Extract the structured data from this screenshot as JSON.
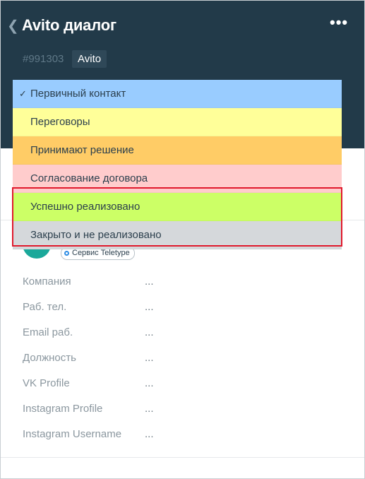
{
  "header": {
    "back_icon": "chevron-left-icon",
    "title": "Avito диалог",
    "more_icon": "more-dots-icon",
    "more_glyph": "•••",
    "lead_id": "#991303",
    "tag": "Avito"
  },
  "stages": [
    {
      "label": "Первичный контакт",
      "color": "#99ccff",
      "selected": true
    },
    {
      "label": "Переговоры",
      "color": "#ffff99",
      "selected": false
    },
    {
      "label": "Принимают решение",
      "color": "#ffcc66",
      "selected": false
    },
    {
      "label": "Согласование договора",
      "color": "#ffcccc",
      "selected": false
    },
    {
      "label": "Успешно реализовано",
      "color": "#ccff66",
      "selected": false
    },
    {
      "label": "Закрыто и не реализовано",
      "color": "#d5d8db",
      "selected": false
    }
  ],
  "contact": {
    "source_badge": "Сервис Teletype"
  },
  "fields": [
    {
      "label": "Компания",
      "value": "..."
    },
    {
      "label": "Раб. тел.",
      "value": "..."
    },
    {
      "label": "Email раб.",
      "value": "..."
    },
    {
      "label": "Должность",
      "value": "..."
    },
    {
      "label": "VK Profile",
      "value": "..."
    },
    {
      "label": "Instagram Profile",
      "value": "..."
    },
    {
      "label": "Instagram Username",
      "value": "..."
    }
  ],
  "colors": {
    "header_bg": "#223a49",
    "highlight_border": "#e0192c",
    "avatar": "#1aa89a"
  }
}
